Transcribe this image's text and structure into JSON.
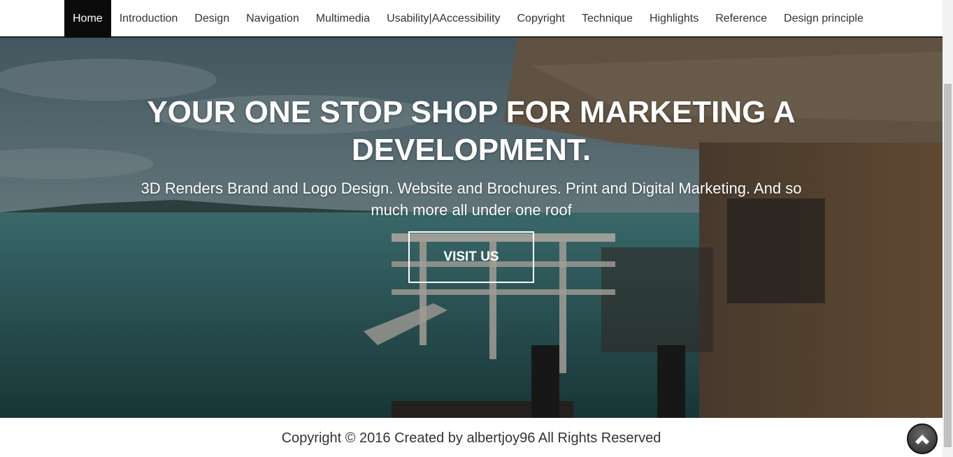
{
  "nav": {
    "items": [
      {
        "label": "Home",
        "active": true
      },
      {
        "label": "Introduction"
      },
      {
        "label": "Design"
      },
      {
        "label": "Navigation"
      },
      {
        "label": "Multimedia"
      },
      {
        "label": "Usability|AAccessibility"
      },
      {
        "label": "Copyright"
      },
      {
        "label": "Technique"
      },
      {
        "label": "Highlights"
      },
      {
        "label": "Reference"
      },
      {
        "label": "Design principle"
      }
    ]
  },
  "hero": {
    "title": "YOUR ONE STOP SHOP FOR MARKETING A DEVELOPMENT.",
    "subtitle": "3D Renders Brand and Logo Design. Website and Brochures. Print and Digital Marketing. And so much more all under one roof",
    "button_label": "VISIT US"
  },
  "footer": {
    "text": "Copyright © 2016 Created by albertjoy96 All Rights Reserved"
  },
  "icons": {
    "back_to_top": "chevron-up-circle-icon"
  },
  "colors": {
    "nav_active_bg": "#0b0b0b",
    "nav_text": "#333333",
    "footer_text": "#333333"
  }
}
